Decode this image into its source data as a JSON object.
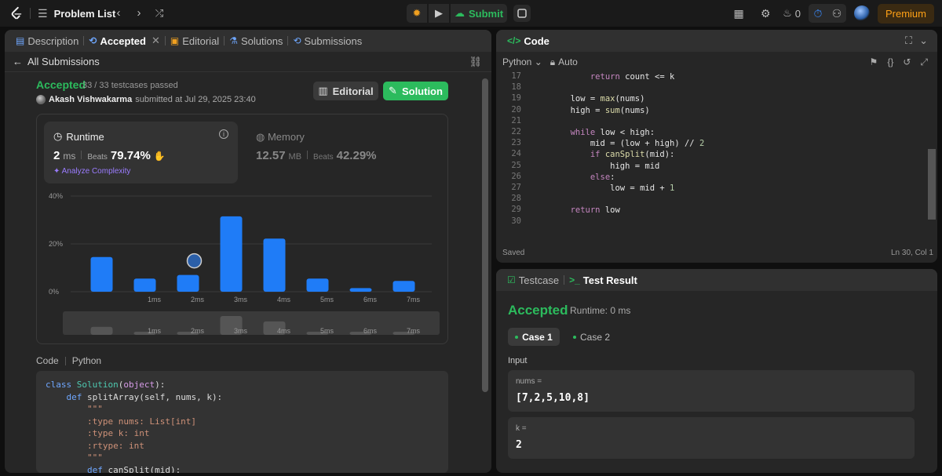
{
  "nav": {
    "title": "Problem List",
    "submit_label": "Submit",
    "streak": "0",
    "premium_label": "Premium"
  },
  "left_tabs": [
    {
      "label": "Description"
    },
    {
      "label": "Accepted"
    },
    {
      "label": "Editorial"
    },
    {
      "label": "Solutions"
    },
    {
      "label": "Submissions"
    }
  ],
  "submission": {
    "back_label": "All Submissions",
    "status": "Accepted",
    "testcases": "33 / 33 testcases passed",
    "author": "Akash Vishwakarma",
    "submitted_text": "submitted at Jul 29, 2025 23:40",
    "editorial_button": "Editorial",
    "solution_button": "Solution"
  },
  "runtime": {
    "label": "Runtime",
    "value": "2",
    "unit": "ms",
    "beats_label": "Beats",
    "beats_value": "79.74%",
    "analyze_label": "Analyze Complexity"
  },
  "memory": {
    "label": "Memory",
    "value": "12.57",
    "unit": "MB",
    "beats_label": "Beats",
    "beats_value": "42.29%"
  },
  "chart_data": {
    "type": "bar",
    "categories": [
      "",
      "1ms",
      "2ms",
      "3ms",
      "4ms",
      "5ms",
      "6ms",
      "7ms"
    ],
    "values": [
      14.5,
      5.5,
      7,
      31.5,
      22.2,
      5.5,
      1.5,
      4.5
    ],
    "yticks": [
      "0%",
      "20%",
      "40%"
    ],
    "ylim": [
      0,
      40
    ],
    "highlight": "2ms",
    "navigator_values": [
      3,
      0.5,
      0.5,
      7,
      5,
      0.5,
      0.5,
      0.5
    ],
    "colors": {
      "bar": "#1f7cf7",
      "grid": "#3a3a3a",
      "nav_bar": "#555555"
    }
  },
  "code_section": {
    "label": "Code",
    "language": "Python"
  },
  "left_code": [
    "class Solution(object):",
    "    def splitArray(self, nums, k):",
    "        \"\"\"",
    "        :type nums: List[int]",
    "        :type k: int",
    "        :rtype: int",
    "        \"\"\"",
    "        def canSplit(mid):"
  ],
  "editor": {
    "title": "Code",
    "language": "Python",
    "mode": "Auto",
    "status": "Saved",
    "cursor": "Ln 30, Col 1",
    "lines": [
      {
        "n": "17",
        "text": "            return count <= k"
      },
      {
        "n": "18",
        "text": ""
      },
      {
        "n": "19",
        "text": "        low = max(nums)"
      },
      {
        "n": "20",
        "text": "        high = sum(nums)"
      },
      {
        "n": "21",
        "text": ""
      },
      {
        "n": "22",
        "text": "        while low < high:"
      },
      {
        "n": "23",
        "text": "            mid = (low + high) // 2"
      },
      {
        "n": "24",
        "text": "            if canSplit(mid):"
      },
      {
        "n": "25",
        "text": "                high = mid"
      },
      {
        "n": "26",
        "text": "            else:"
      },
      {
        "n": "27",
        "text": "                low = mid + 1"
      },
      {
        "n": "28",
        "text": ""
      },
      {
        "n": "29",
        "text": "        return low"
      },
      {
        "n": "30",
        "text": ""
      }
    ]
  },
  "result_tabs": [
    {
      "label": "Testcase"
    },
    {
      "label": "Test Result"
    }
  ],
  "result": {
    "status": "Accepted",
    "runtime": "Runtime: 0 ms",
    "case1": "Case 1",
    "case2": "Case 2",
    "input_label": "Input",
    "inputs": [
      {
        "name": "nums =",
        "value": "[7,2,5,10,8]"
      },
      {
        "name": "k =",
        "value": "2"
      }
    ]
  }
}
